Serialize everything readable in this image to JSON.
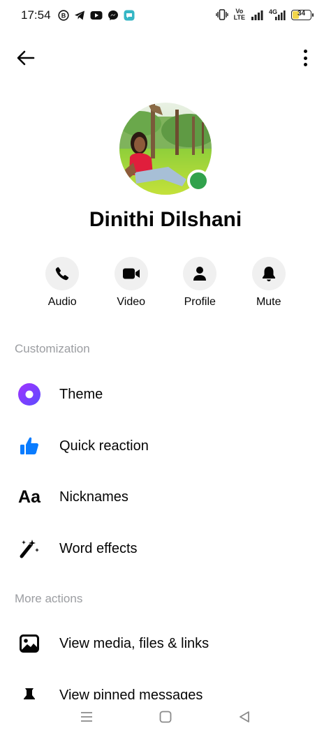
{
  "status_bar": {
    "time": "17:54",
    "battery": "34",
    "battery_level_percent": 34,
    "network_label": "4G",
    "volte_label_top": "Vo",
    "volte_label_bottom": "LTE",
    "app_icons": [
      "b-badge-icon",
      "telegram-icon",
      "youtube-icon",
      "messenger-icon",
      "chat-app-icon"
    ]
  },
  "header": {
    "back_icon": "arrow-left-icon",
    "more_icon": "more-vertical-icon"
  },
  "profile": {
    "name": "Dinithi Dilshani",
    "online": true,
    "presence_color": "#31a24c"
  },
  "actions": [
    {
      "label": "Audio",
      "icon": "phone-icon"
    },
    {
      "label": "Video",
      "icon": "video-camera-icon"
    },
    {
      "label": "Profile",
      "icon": "person-icon"
    },
    {
      "label": "Mute",
      "icon": "bell-icon"
    }
  ],
  "sections": {
    "customization": {
      "title": "Customization",
      "items": [
        {
          "label": "Theme",
          "icon": "theme-icon"
        },
        {
          "label": "Quick reaction",
          "icon": "thumbs-up-icon"
        },
        {
          "label": "Nicknames",
          "icon": "aa-text-icon",
          "icon_text": "Aa"
        },
        {
          "label": "Word effects",
          "icon": "magic-wand-icon"
        }
      ]
    },
    "more_actions": {
      "title": "More actions",
      "items": [
        {
          "label": "View media, files & links",
          "icon": "image-icon"
        },
        {
          "label": "View pinned messages",
          "icon": "pin-icon"
        }
      ]
    }
  },
  "colors": {
    "accent_blue": "#0a7cff",
    "theme_gradient_start": "#a033ff",
    "theme_gradient_end": "#5b4bff",
    "section_title": "#9b9da1"
  },
  "nav_bar": {
    "buttons": [
      "menu-icon",
      "home-square-icon",
      "back-triangle-icon"
    ]
  }
}
